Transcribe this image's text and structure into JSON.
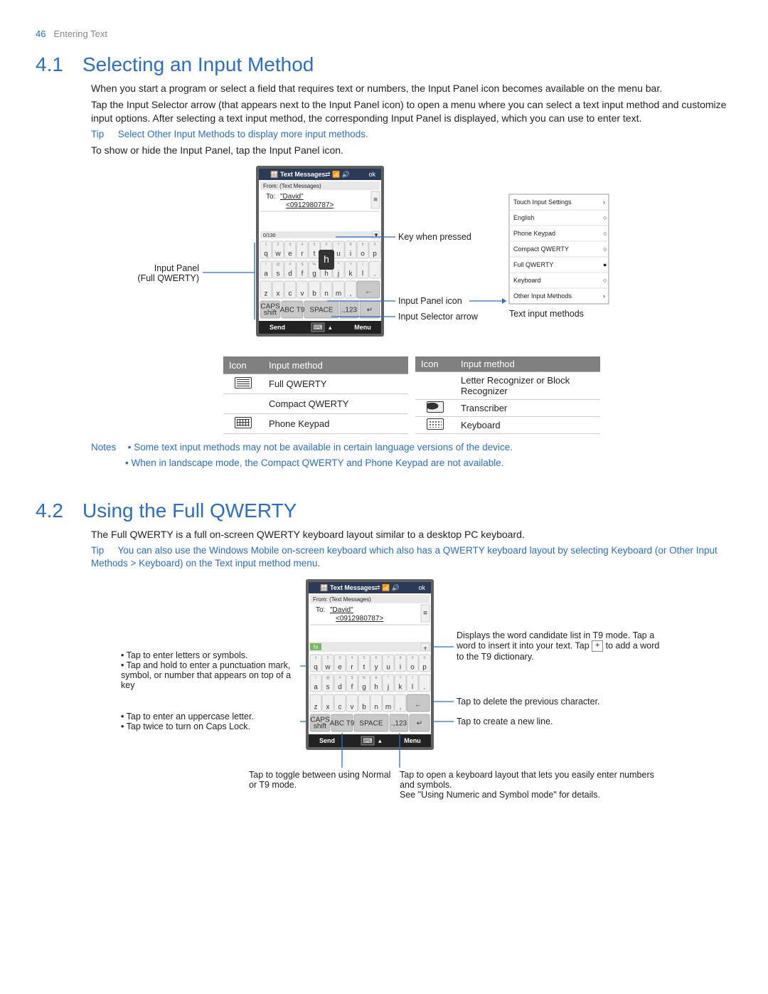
{
  "header": {
    "page_num": "46",
    "chapter": "Entering Text"
  },
  "s41": {
    "num": "4.1",
    "title": "Selecting an Input Method",
    "p1_a": "When you start a program or select a field that requires text or numbers, the ",
    "p1_b": "Input Panel",
    "p1_c": " icon becomes available on the menu bar.",
    "p2": "Tap the Input Selector arrow (that appears next to the Input Panel icon) to open a menu where you can select a text input method and customize input options. After selecting a text input method, the corresponding Input Panel is displayed, which you can use to enter text.",
    "tip_label": "Tip",
    "tip": "Select Other Input Methods to display more input methods.",
    "p3": "To show or hide the Input Panel, tap the Input Panel icon."
  },
  "fig1": {
    "title_bar": "Text Messages",
    "ok": "ok",
    "from": "From: (Text Messages)",
    "to_label": "To:",
    "to_name": "\"David\"",
    "to_num": "<0912980787>",
    "counter": "0/130",
    "send": "Send",
    "menu": "Menu",
    "row1_sym": [
      "1",
      "2",
      "3",
      "4",
      "5",
      "6",
      "7",
      "8",
      "9",
      "0"
    ],
    "row1": [
      "q",
      "w",
      "e",
      "r",
      "t",
      "y",
      "u",
      "i",
      "o",
      "p"
    ],
    "row2_sym": [
      "!",
      "@",
      "#",
      "$",
      "%",
      "&",
      "*",
      "?",
      "/"
    ],
    "row2": [
      "a",
      "s",
      "d",
      "f",
      "g",
      "h",
      "j",
      "k",
      "l",
      "."
    ],
    "row3": [
      "z",
      "x",
      "c",
      "v",
      "b",
      "n",
      "m",
      ","
    ],
    "caps": "CAPS",
    "shift": "shift",
    "abc_t9": "ABC T9",
    "space": "SPACE",
    "num": ".,123",
    "key_pressed": "h",
    "label_left1": "Input Panel",
    "label_left2": "(Full QWERTY)",
    "label_right1": "Key when pressed",
    "label_right2": "Input Panel icon",
    "label_right3": "Input Selector arrow",
    "label_right4": "Text input methods",
    "popup": {
      "items": [
        "Touch Input Settings",
        "English",
        "Phone Keypad",
        "Compact QWERTY",
        "Full QWERTY",
        "Keyboard",
        "Other Input Methods"
      ]
    }
  },
  "tables": {
    "h_icon": "Icon",
    "h_method": "Input method",
    "left": [
      "Full QWERTY",
      "Compact QWERTY",
      "Phone Keypad"
    ],
    "right": [
      "Letter Recognizer or Block Recognizer",
      "Transcriber",
      "Keyboard"
    ]
  },
  "notes": {
    "label": "Notes",
    "n1": "• Some text input methods may not be available in certain language versions of the device.",
    "n2": "• When in landscape mode, the Compact QWERTY and Phone Keypad are not available."
  },
  "s42": {
    "num": "4.2",
    "title": "Using the Full QWERTY",
    "p1": "The Full QWERTY is a full on-screen QWERTY keyboard layout similar to a desktop PC keyboard.",
    "tip_label": "Tip",
    "tip": "You can also use the Windows Mobile on-screen keyboard which also has a QWERTY keyboard layout by selecting Keyboard (or Other Input Methods > Keyboard) on the Text input method menu."
  },
  "fig2": {
    "title_bar": "Text Messages",
    "ok": "ok",
    "from": "From: (Text Messages)",
    "to_label": "To:",
    "to_name": "\"David\"",
    "to_num": "<0912980787>",
    "candidate": "hi",
    "row1_sym": [
      "1",
      "2",
      "3",
      "4",
      "5",
      "6",
      "7",
      "8",
      "9",
      "0"
    ],
    "row1": [
      "q",
      "w",
      "e",
      "r",
      "t",
      "y",
      "u",
      "i",
      "o",
      "p"
    ],
    "row2_sym": [
      "!",
      "@",
      "#",
      "$",
      "%",
      "&",
      "*",
      "?",
      "/"
    ],
    "row2": [
      "a",
      "s",
      "d",
      "f",
      "g",
      "h",
      "j",
      "k",
      "l",
      "."
    ],
    "row3": [
      "z",
      "x",
      "c",
      "v",
      "b",
      "n",
      "m",
      ","
    ],
    "caps": "CAPS",
    "shift": "shift",
    "abc_t9": "ABC T9",
    "space": "SPACE",
    "num": ".,123",
    "send": "Send",
    "menu": "Menu",
    "left_a": "• Tap to enter letters or symbols.",
    "left_b": "• Tap and hold to enter a punctuation mark, symbol, or number that appears on top of a key",
    "left_c": "• Tap to enter an uppercase letter.",
    "left_d": "• Tap twice to turn on Caps Lock.",
    "right_a1": "Displays the word candidate list in T9 mode. Tap a word to insert it into your text. Tap ",
    "right_a2": " to add a word to the T9 dictionary.",
    "right_b": "Tap to delete the previous character.",
    "right_c": "Tap to create a new line.",
    "bottom_a": "Tap to toggle between using Normal or T9 mode.",
    "bottom_b": "Tap to open a keyboard layout that lets you easily enter numbers and symbols.",
    "bottom_c": "See \"Using Numeric and Symbol mode\" for details."
  }
}
